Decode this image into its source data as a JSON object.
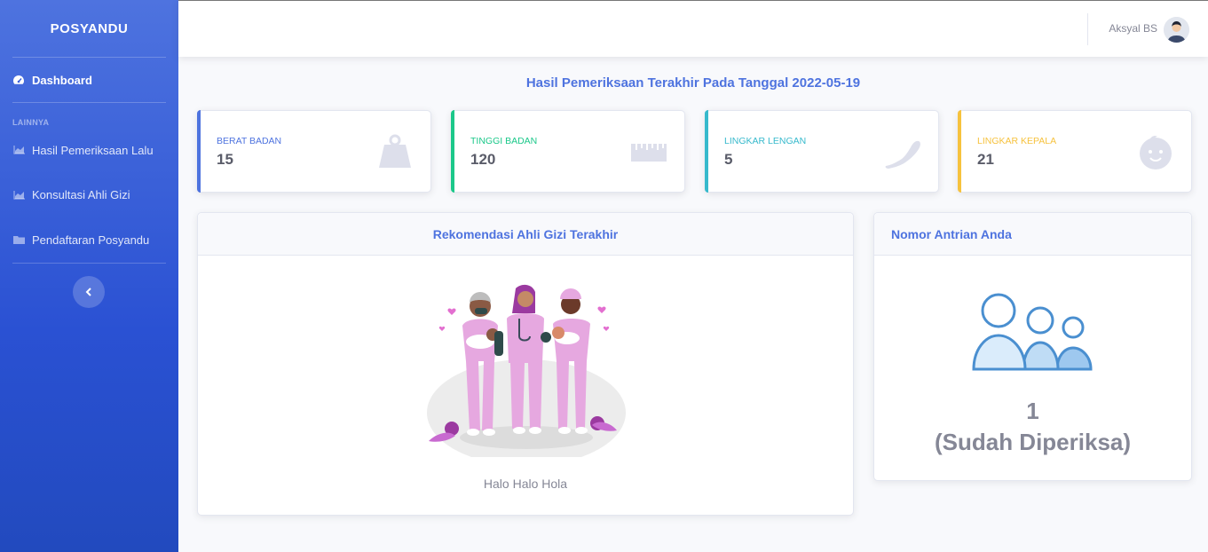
{
  "sidebar": {
    "brand": "POSYANDU",
    "dashboard_label": "Dashboard",
    "section_heading": "LAINNYA",
    "items": [
      {
        "label": "Hasil Pemeriksaan Lalu",
        "icon": "chart-area-icon"
      },
      {
        "label": "Konsultasi Ahli Gizi",
        "icon": "chart-area-icon"
      },
      {
        "label": "Pendaftaran Posyandu",
        "icon": "folder-icon"
      }
    ]
  },
  "topbar": {
    "user_name": "Aksyal BS"
  },
  "main": {
    "heading": "Hasil Pemeriksaan Terakhir Pada Tanggal 2022-05-19",
    "stats": [
      {
        "label": "BERAT BADAN",
        "value": "15",
        "color": "#4e73df",
        "icon": "weight-icon"
      },
      {
        "label": "TINGGI BADAN",
        "value": "120",
        "color": "#1cc88a",
        "icon": "ruler-icon"
      },
      {
        "label": "LINGKAR LENGAN",
        "value": "5",
        "color": "#36b9cc",
        "icon": "arm-icon"
      },
      {
        "label": "LINGKAR KEPALA",
        "value": "21",
        "color": "#f6c23e",
        "icon": "baby-face-icon"
      }
    ],
    "recommendation": {
      "title": "Rekomendasi Ahli Gizi Terakhir",
      "caption": "Halo Halo Hola"
    },
    "queue": {
      "title": "Nomor Antrian Anda",
      "number": "1",
      "status": "(Sudah Diperiksa)"
    }
  }
}
